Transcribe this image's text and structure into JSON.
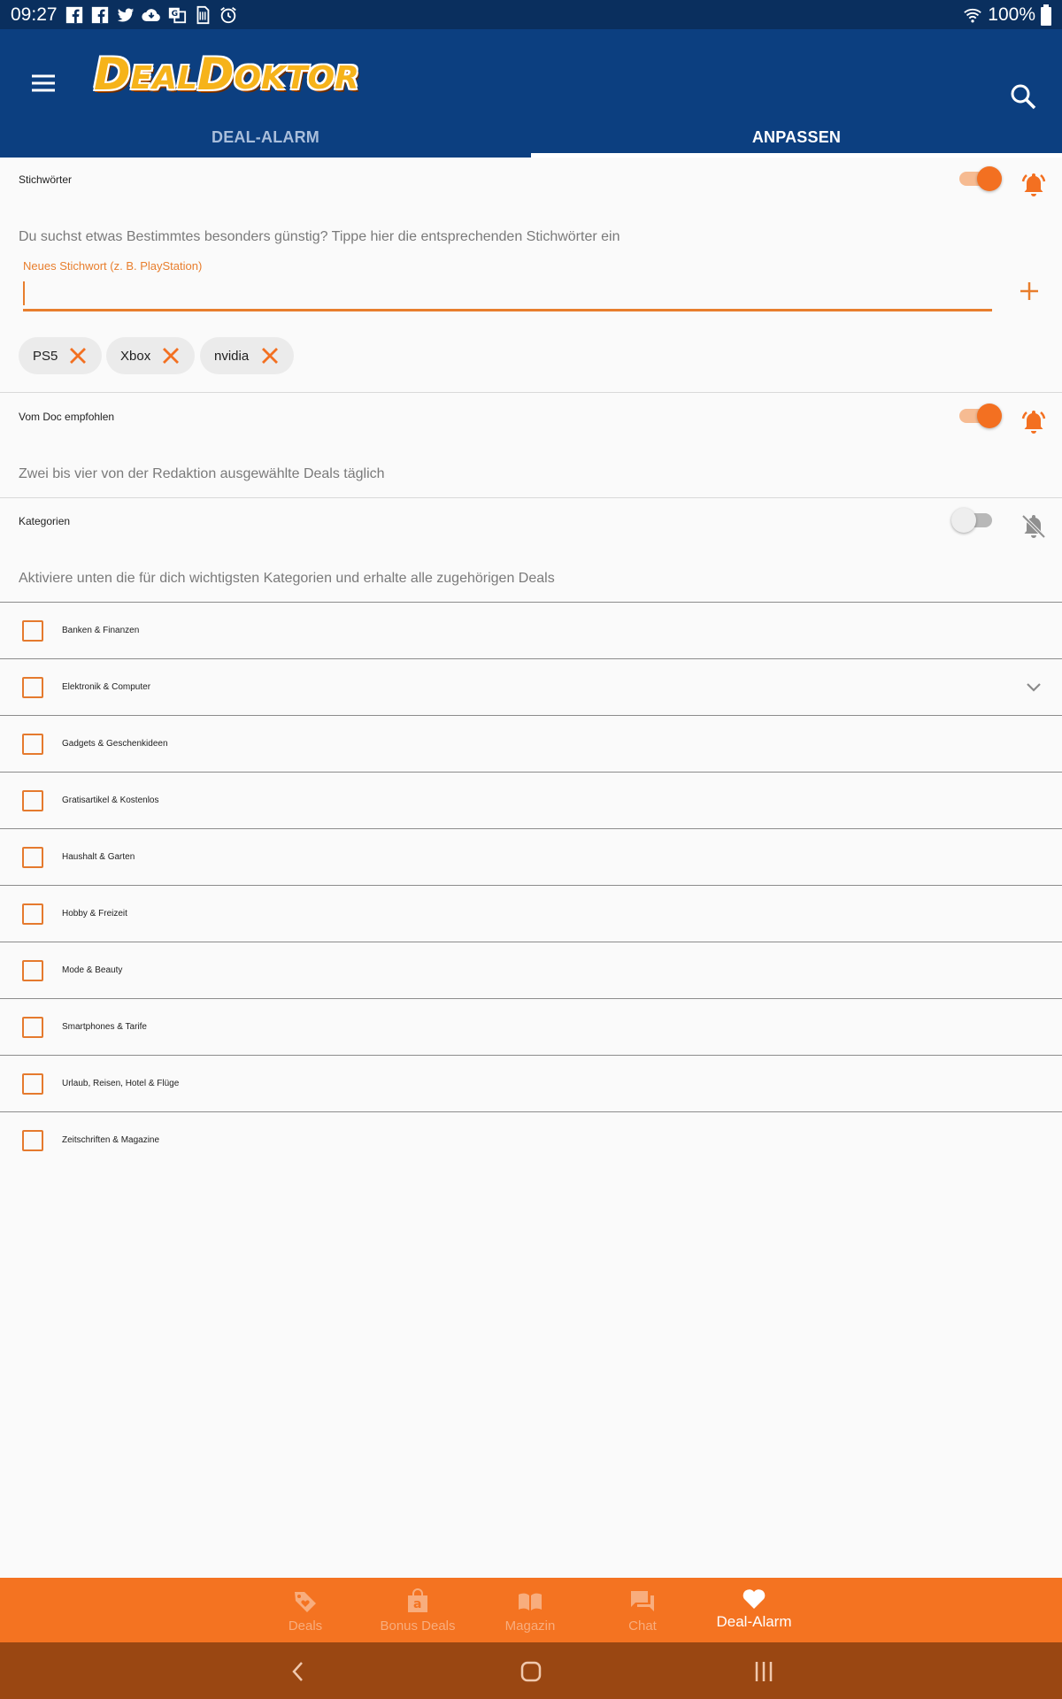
{
  "status_bar": {
    "time": "09:27",
    "battery": "100%",
    "icons": [
      "facebook-icon",
      "facebook-icon",
      "twitter-icon",
      "cloud-download-icon",
      "translate-icon",
      "sim-icon",
      "alarm-icon",
      "wifi-icon",
      "battery-icon"
    ]
  },
  "app_bar": {
    "logo": {
      "part1_big": "D",
      "part1_small": "EAL",
      "part2_big": "D",
      "part2_small": "OKTOR"
    },
    "tabs": [
      {
        "label": "DEAL-ALARM",
        "active": false
      },
      {
        "label": "ANPASSEN",
        "active": true
      }
    ]
  },
  "keywords": {
    "title": "Stichwörter",
    "enabled": true,
    "description": "Du suchst etwas Bestimmtes besonders günstig? Tippe hier die entsprechenden Stichwörter ein",
    "input_label": "Neues Stichwort (z. B. PlayStation)",
    "input_value": "",
    "chips": [
      "PS5",
      "Xbox",
      "nvidia"
    ]
  },
  "recommended": {
    "title": "Vom Doc empfohlen",
    "enabled": true,
    "description": "Zwei bis vier von der Redaktion ausgewählte Deals täglich"
  },
  "categories": {
    "title": "Kategorien",
    "enabled": false,
    "description": "Aktiviere unten die für dich wichtigsten Kategorien und erhalte alle zugehörigen Deals",
    "items": [
      {
        "label": "Banken & Finanzen",
        "checked": false,
        "expandable": false
      },
      {
        "label": "Elektronik & Computer",
        "checked": false,
        "expandable": true
      },
      {
        "label": "Gadgets & Geschenkideen",
        "checked": false,
        "expandable": false
      },
      {
        "label": "Gratisartikel & Kostenlos",
        "checked": false,
        "expandable": false
      },
      {
        "label": "Haushalt & Garten",
        "checked": false,
        "expandable": false
      },
      {
        "label": "Hobby & Freizeit",
        "checked": false,
        "expandable": false
      },
      {
        "label": "Mode & Beauty",
        "checked": false,
        "expandable": false
      },
      {
        "label": "Smartphones & Tarife",
        "checked": false,
        "expandable": false
      },
      {
        "label": "Urlaub, Reisen, Hotel & Flüge",
        "checked": false,
        "expandable": false
      },
      {
        "label": "Zeitschriften & Magazine",
        "checked": false,
        "expandable": false
      }
    ]
  },
  "bottom_nav": {
    "items": [
      {
        "label": "Deals",
        "icon": "tag-heart-icon",
        "active": false
      },
      {
        "label": "Bonus Deals",
        "icon": "amazon-bag-icon",
        "active": false
      },
      {
        "label": "Magazin",
        "icon": "book-icon",
        "active": false
      },
      {
        "label": "Chat",
        "icon": "chat-icon",
        "active": false
      },
      {
        "label": "Deal-Alarm",
        "icon": "heart-icon",
        "active": true
      }
    ]
  },
  "colors": {
    "primary": "#0c3f80",
    "status_bar": "#0a2f5e",
    "accent": "#f37021",
    "bottom_nav": "#f47321",
    "system_nav": "#9a4712"
  }
}
